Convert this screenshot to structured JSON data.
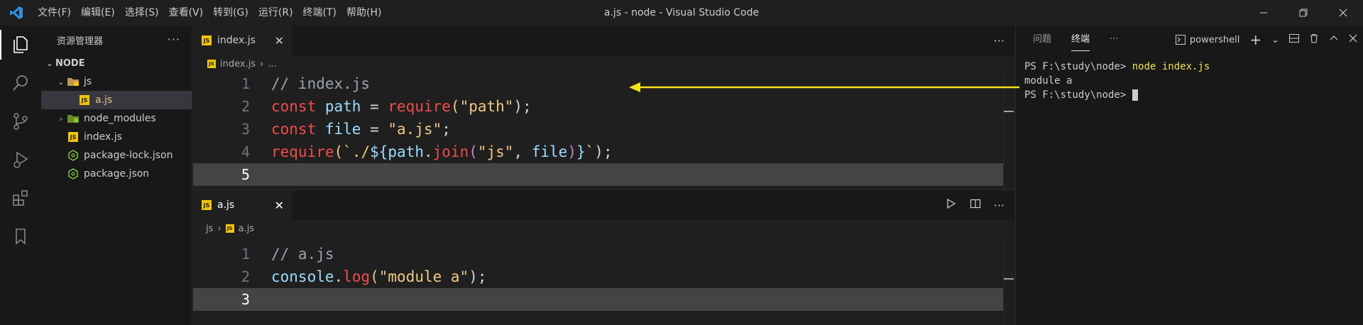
{
  "window": {
    "title": "a.js - node - Visual Studio Code"
  },
  "menu": [
    "文件(F)",
    "编辑(E)",
    "选择(S)",
    "查看(V)",
    "转到(G)",
    "运行(R)",
    "终端(T)",
    "帮助(H)"
  ],
  "sidebar": {
    "title": "资源管理器",
    "more": "···",
    "root": "NODE",
    "items": [
      {
        "label": "js"
      },
      {
        "label": "a.js"
      },
      {
        "label": "node_modules"
      },
      {
        "label": "index.js"
      },
      {
        "label": "package-lock.json"
      },
      {
        "label": "package.json"
      }
    ]
  },
  "editor_top": {
    "tab_label": "index.js",
    "breadcrumb": [
      "index.js",
      "..."
    ],
    "line_numbers": [
      "1",
      "2",
      "3",
      "4",
      "5"
    ],
    "code": {
      "l1": "// index.js",
      "l2_kw": "const",
      "l2_var": "path",
      "l2_eq": " = ",
      "l2_fn": "require",
      "l2_open": "(",
      "l2_str": "\"path\"",
      "l2_close": ");",
      "l3_kw": "const",
      "l3_var": "file",
      "l3_eq": " = ",
      "l3_str": "\"a.js\"",
      "l3_end": ";",
      "l4_fn": "require",
      "l4_open": "(",
      "l4_tick1": "`./",
      "l4_dollar": "${",
      "l4_path": "path",
      "l4_dot": ".",
      "l4_join": "join",
      "l4_jopen": "(",
      "l4_js": "\"js\"",
      "l4_comma": ", ",
      "l4_file": "file",
      "l4_jclose": ")",
      "l4_brace": "}",
      "l4_tick2": "`",
      "l4_end": ");"
    }
  },
  "editor_bottom": {
    "tab_label": "a.js",
    "tab_close": "✕",
    "breadcrumb": [
      "js",
      "a.js"
    ],
    "line_numbers": [
      "1",
      "2",
      "3"
    ],
    "code": {
      "l1": "// a.js",
      "l2_obj": "console",
      "l2_dot": ".",
      "l2_fn": "log",
      "l2_open": "(",
      "l2_str": "\"module a\"",
      "l2_end": ");"
    }
  },
  "panel": {
    "tabs": [
      "问题",
      "终端"
    ],
    "more": "···",
    "shell": "powershell",
    "terminal": {
      "prompt1": "PS F:\\study\\node> ",
      "cmd1": "node index.js",
      "output1": "module a",
      "prompt2": "PS F:\\study\\node> "
    }
  },
  "colors": {
    "accent_yellow": "#f5e11c",
    "js_badge": "#f1c40f",
    "keyword": "#f14c4c",
    "variable": "#9cdcfe",
    "string": "#f0c987"
  }
}
